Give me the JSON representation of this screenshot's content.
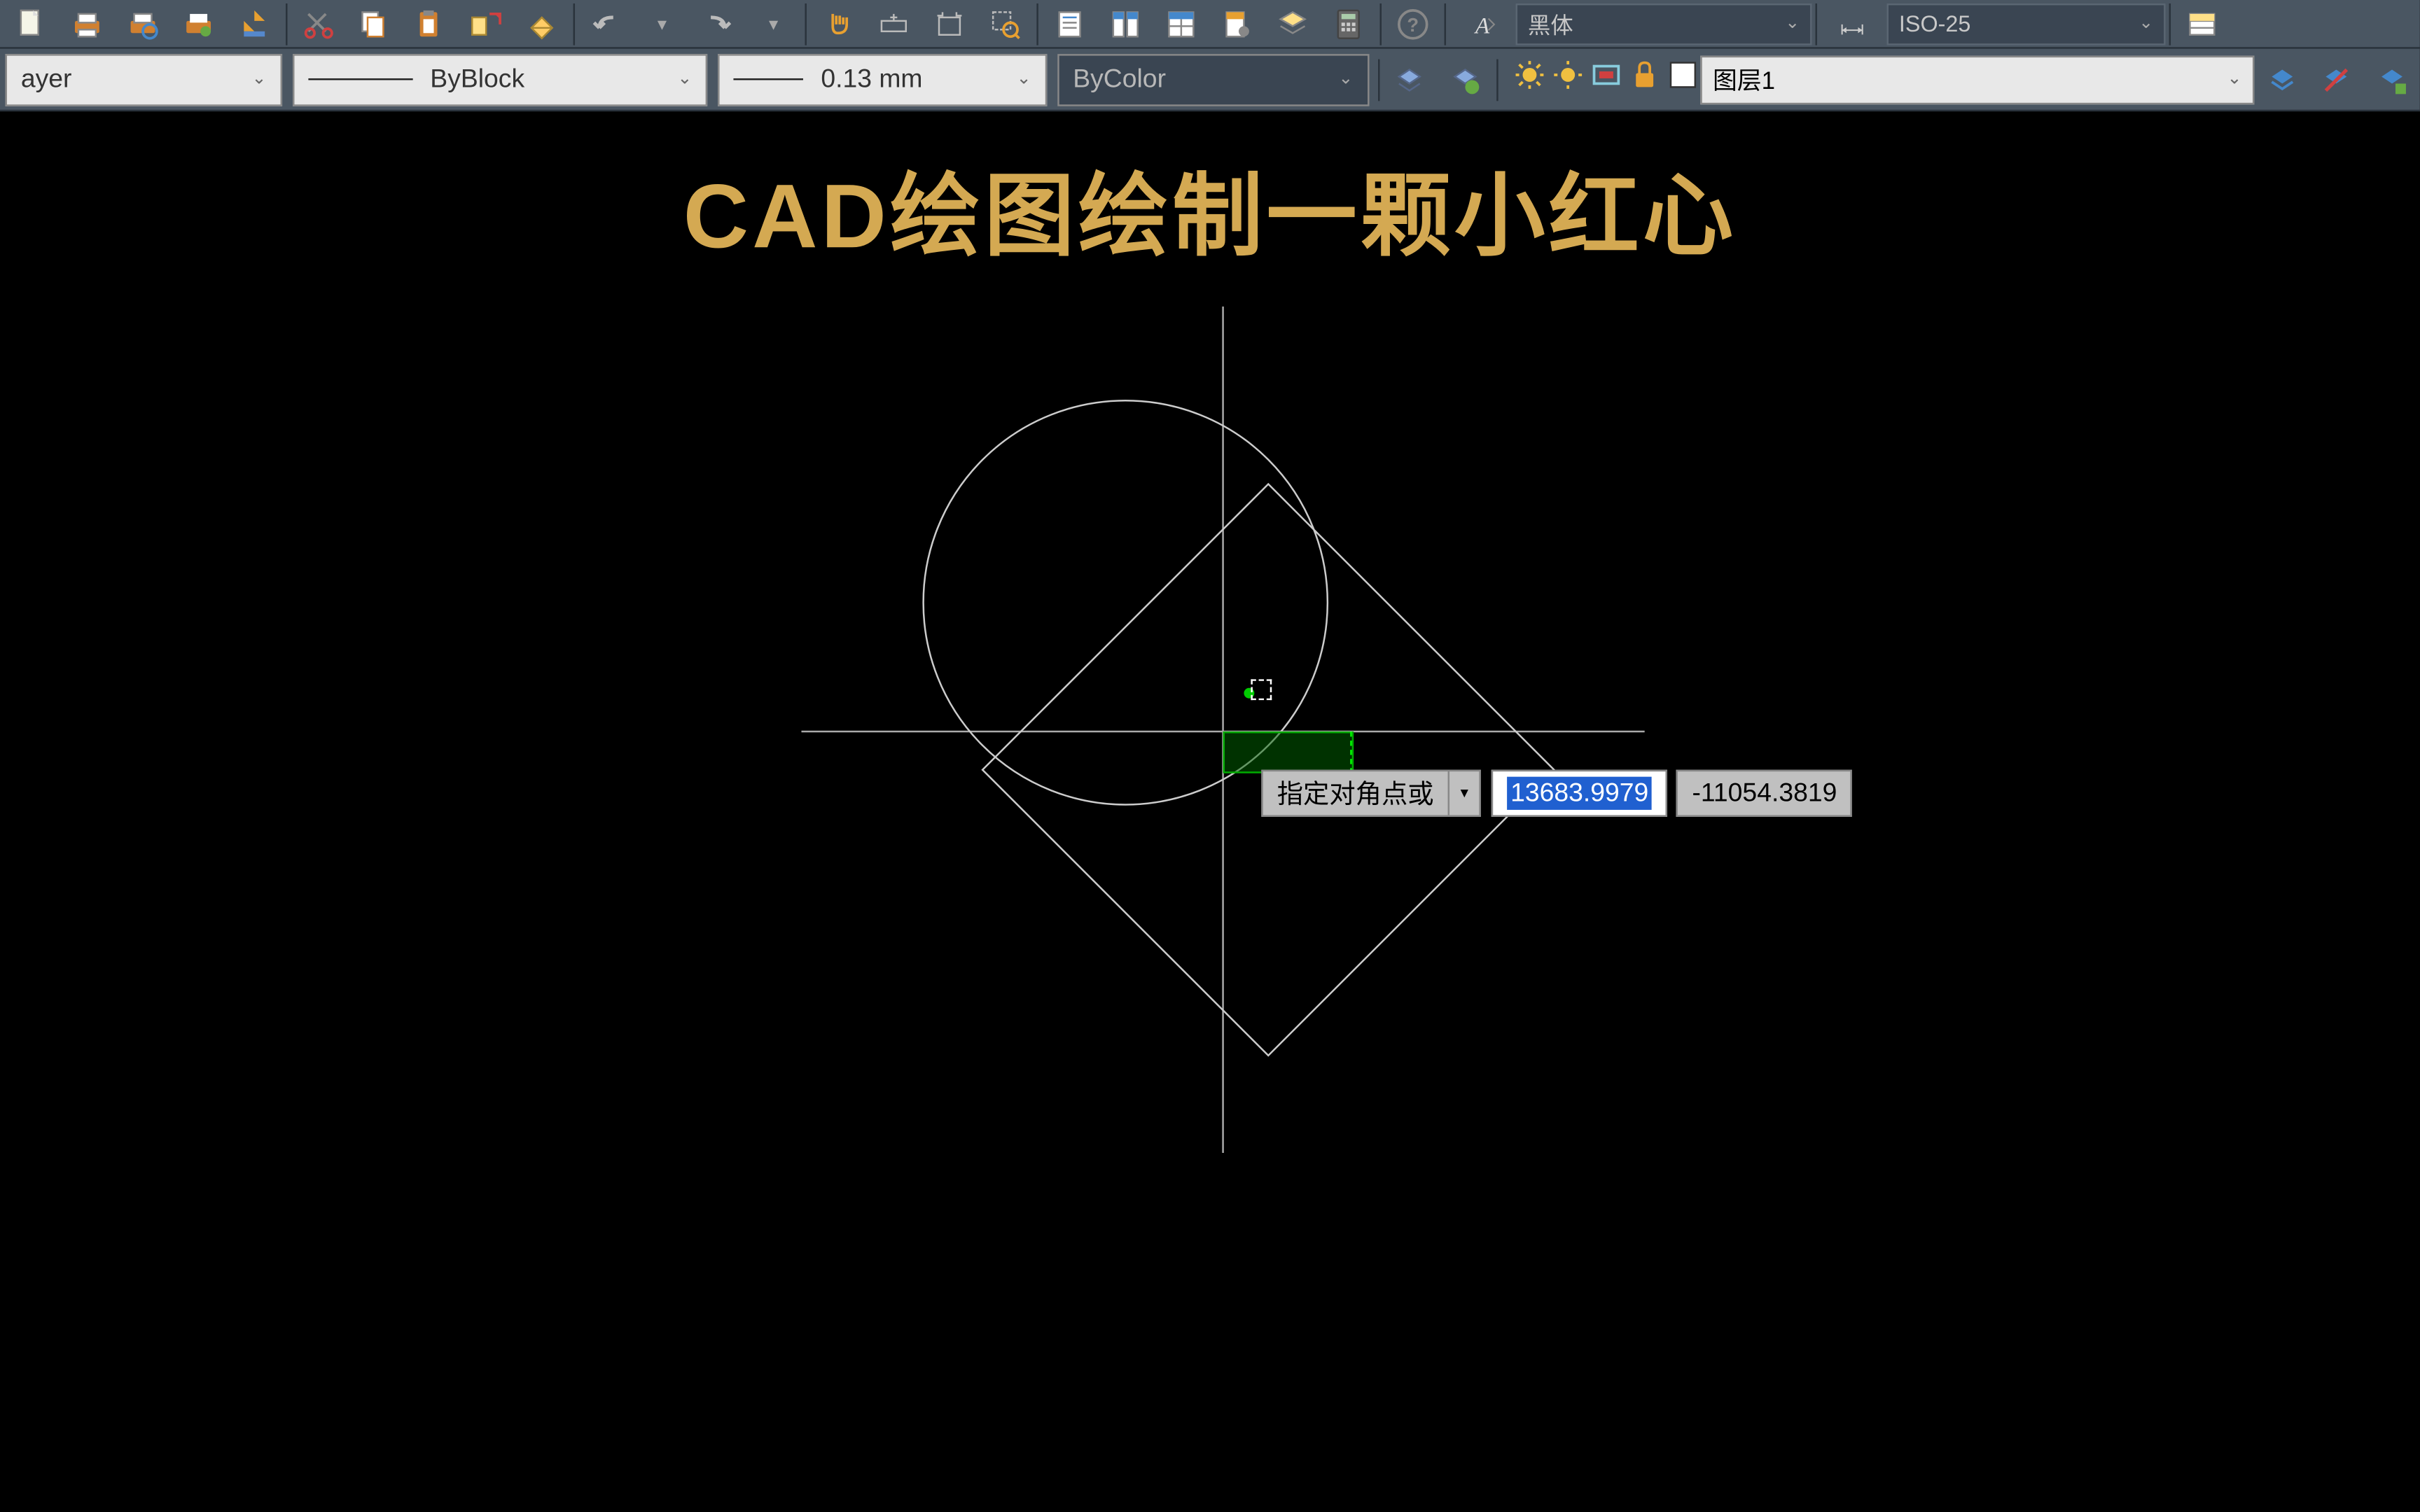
{
  "toolbar1": {
    "font_style": "黑体",
    "dim_style": "ISO-25"
  },
  "toolbar2": {
    "layer_label": "ayer",
    "linetype": "ByBlock",
    "lineweight": "0.13 mm",
    "color": "ByColor",
    "layer_name": "图层1"
  },
  "canvas": {
    "title": "CAD绘图绘制一颗小红心"
  },
  "dynamic_input": {
    "prompt": "指定对角点或",
    "x_value": "13683.9979",
    "y_value": "-11054.3819"
  }
}
